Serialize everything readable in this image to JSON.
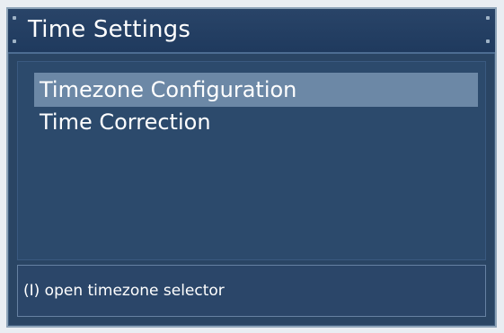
{
  "window": {
    "title": "Time Settings"
  },
  "menu": {
    "items": [
      {
        "label": "Timezone Configuration",
        "selected": true
      },
      {
        "label": "Time Correction",
        "selected": false
      }
    ]
  },
  "status": {
    "hint": "(I) open timezone selector"
  },
  "colors": {
    "background": "#2a4564",
    "title_bar": "#294468",
    "selection": "#6c88a6",
    "text": "#ffffff",
    "border": "#8da3b8"
  }
}
